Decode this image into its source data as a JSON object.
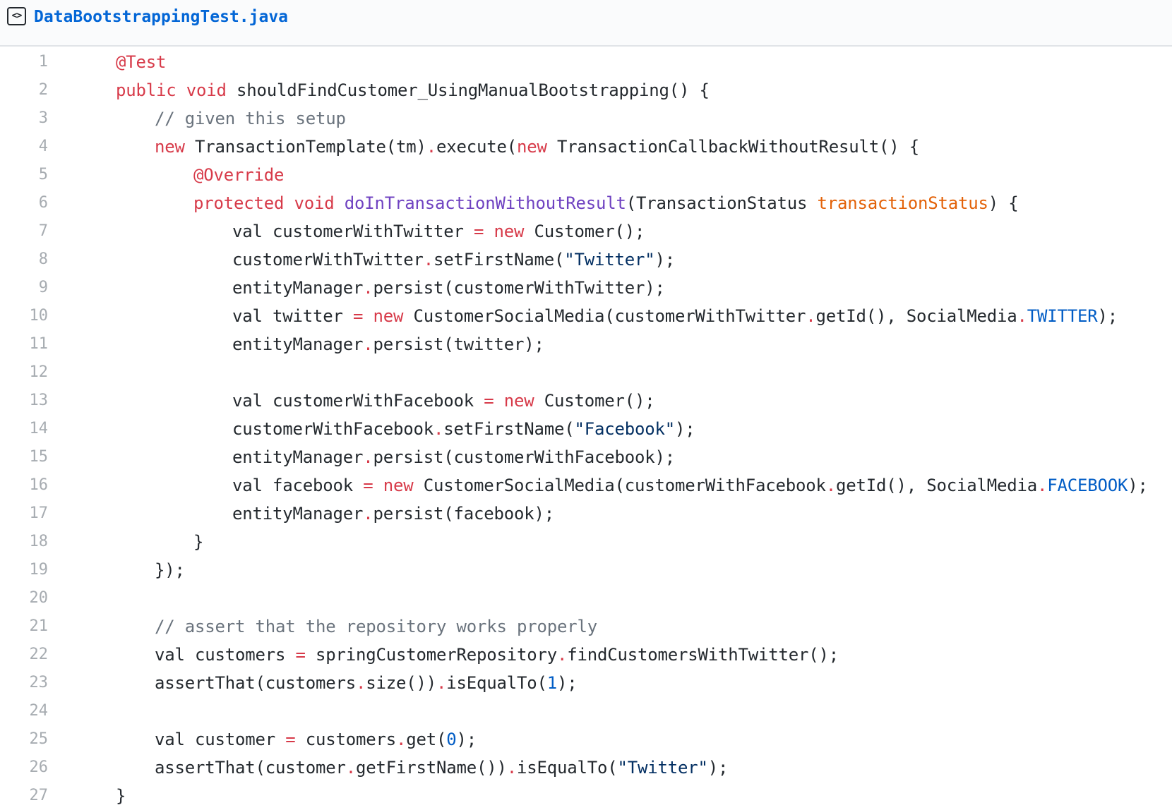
{
  "file": {
    "icon": "code-file-icon",
    "icon_glyph": "<>",
    "name": "DataBootstrappingTest.java"
  },
  "colors": {
    "keyword": "#d73a49",
    "comment": "#6a737d",
    "function": "#6f42c1",
    "parameter": "#e36209",
    "constant": "#005cc5",
    "string": "#032f62",
    "text": "#24292e",
    "line_number": "#a7acb1",
    "link": "#0366d6"
  },
  "code": {
    "lines": [
      {
        "num": "1",
        "indent": 0,
        "tokens": [
          {
            "t": "@Test",
            "c": "an"
          }
        ]
      },
      {
        "num": "2",
        "indent": 0,
        "tokens": [
          {
            "t": "public",
            "c": "kw"
          },
          {
            "t": " "
          },
          {
            "t": "void",
            "c": "kw"
          },
          {
            "t": " shouldFindCustomer_UsingManualBootstrapping() {"
          }
        ]
      },
      {
        "num": "3",
        "indent": 1,
        "tokens": [
          {
            "t": "// given this setup",
            "c": "cm"
          }
        ]
      },
      {
        "num": "4",
        "indent": 1,
        "tokens": [
          {
            "t": "new",
            "c": "kw"
          },
          {
            "t": " TransactionTemplate(tm)"
          },
          {
            "t": ".",
            "c": "op"
          },
          {
            "t": "execute("
          },
          {
            "t": "new",
            "c": "kw"
          },
          {
            "t": " TransactionCallbackWithoutResult() {"
          }
        ]
      },
      {
        "num": "5",
        "indent": 2,
        "tokens": [
          {
            "t": "@Override",
            "c": "an"
          }
        ]
      },
      {
        "num": "6",
        "indent": 2,
        "tokens": [
          {
            "t": "protected",
            "c": "kw"
          },
          {
            "t": " "
          },
          {
            "t": "void",
            "c": "kw"
          },
          {
            "t": " "
          },
          {
            "t": "doInTransactionWithoutResult",
            "c": "fn"
          },
          {
            "t": "(TransactionStatus "
          },
          {
            "t": "transactionStatus",
            "c": "pa"
          },
          {
            "t": ") {"
          }
        ]
      },
      {
        "num": "7",
        "indent": 3,
        "tokens": [
          {
            "t": "val customerWithTwitter "
          },
          {
            "t": "=",
            "c": "op"
          },
          {
            "t": " "
          },
          {
            "t": "new",
            "c": "kw"
          },
          {
            "t": " Customer();"
          }
        ]
      },
      {
        "num": "8",
        "indent": 3,
        "tokens": [
          {
            "t": "customerWithTwitter"
          },
          {
            "t": ".",
            "c": "op"
          },
          {
            "t": "setFirstName("
          },
          {
            "t": "\"Twitter\"",
            "c": "st"
          },
          {
            "t": ");"
          }
        ]
      },
      {
        "num": "9",
        "indent": 3,
        "tokens": [
          {
            "t": "entityManager"
          },
          {
            "t": ".",
            "c": "op"
          },
          {
            "t": "persist(customerWithTwitter);"
          }
        ]
      },
      {
        "num": "10",
        "indent": 3,
        "tokens": [
          {
            "t": "val twitter "
          },
          {
            "t": "=",
            "c": "op"
          },
          {
            "t": " "
          },
          {
            "t": "new",
            "c": "kw"
          },
          {
            "t": " CustomerSocialMedia(customerWithTwitter"
          },
          {
            "t": ".",
            "c": "op"
          },
          {
            "t": "getId(), SocialMedia"
          },
          {
            "t": ".",
            "c": "op"
          },
          {
            "t": "TWITTER",
            "c": "co"
          },
          {
            "t": ");"
          }
        ]
      },
      {
        "num": "11",
        "indent": 3,
        "tokens": [
          {
            "t": "entityManager"
          },
          {
            "t": ".",
            "c": "op"
          },
          {
            "t": "persist(twitter);"
          }
        ]
      },
      {
        "num": "12",
        "indent": 0,
        "tokens": []
      },
      {
        "num": "13",
        "indent": 3,
        "tokens": [
          {
            "t": "val customerWithFacebook "
          },
          {
            "t": "=",
            "c": "op"
          },
          {
            "t": " "
          },
          {
            "t": "new",
            "c": "kw"
          },
          {
            "t": " Customer();"
          }
        ]
      },
      {
        "num": "14",
        "indent": 3,
        "tokens": [
          {
            "t": "customerWithFacebook"
          },
          {
            "t": ".",
            "c": "op"
          },
          {
            "t": "setFirstName("
          },
          {
            "t": "\"Facebook\"",
            "c": "st"
          },
          {
            "t": ");"
          }
        ]
      },
      {
        "num": "15",
        "indent": 3,
        "tokens": [
          {
            "t": "entityManager"
          },
          {
            "t": ".",
            "c": "op"
          },
          {
            "t": "persist(customerWithFacebook);"
          }
        ]
      },
      {
        "num": "16",
        "indent": 3,
        "tokens": [
          {
            "t": "val facebook "
          },
          {
            "t": "=",
            "c": "op"
          },
          {
            "t": " "
          },
          {
            "t": "new",
            "c": "kw"
          },
          {
            "t": " CustomerSocialMedia(customerWithFacebook"
          },
          {
            "t": ".",
            "c": "op"
          },
          {
            "t": "getId(), SocialMedia"
          },
          {
            "t": ".",
            "c": "op"
          },
          {
            "t": "FACEBOOK",
            "c": "co"
          },
          {
            "t": ");"
          }
        ]
      },
      {
        "num": "17",
        "indent": 3,
        "tokens": [
          {
            "t": "entityManager"
          },
          {
            "t": ".",
            "c": "op"
          },
          {
            "t": "persist(facebook);"
          }
        ]
      },
      {
        "num": "18",
        "indent": 2,
        "tokens": [
          {
            "t": "}"
          }
        ]
      },
      {
        "num": "19",
        "indent": 1,
        "tokens": [
          {
            "t": "});"
          }
        ]
      },
      {
        "num": "20",
        "indent": 0,
        "tokens": []
      },
      {
        "num": "21",
        "indent": 1,
        "tokens": [
          {
            "t": "// assert that the repository works properly",
            "c": "cm"
          }
        ]
      },
      {
        "num": "22",
        "indent": 1,
        "tokens": [
          {
            "t": "val customers "
          },
          {
            "t": "=",
            "c": "op"
          },
          {
            "t": " springCustomerRepository"
          },
          {
            "t": ".",
            "c": "op"
          },
          {
            "t": "findCustomersWithTwitter();"
          }
        ]
      },
      {
        "num": "23",
        "indent": 1,
        "tokens": [
          {
            "t": "assertThat(customers"
          },
          {
            "t": ".",
            "c": "op"
          },
          {
            "t": "size())"
          },
          {
            "t": ".",
            "c": "op"
          },
          {
            "t": "isEqualTo("
          },
          {
            "t": "1",
            "c": "co"
          },
          {
            "t": ");"
          }
        ]
      },
      {
        "num": "24",
        "indent": 0,
        "tokens": []
      },
      {
        "num": "25",
        "indent": 1,
        "tokens": [
          {
            "t": "val customer "
          },
          {
            "t": "=",
            "c": "op"
          },
          {
            "t": " customers"
          },
          {
            "t": ".",
            "c": "op"
          },
          {
            "t": "get("
          },
          {
            "t": "0",
            "c": "co"
          },
          {
            "t": ");"
          }
        ]
      },
      {
        "num": "26",
        "indent": 1,
        "tokens": [
          {
            "t": "assertThat(customer"
          },
          {
            "t": ".",
            "c": "op"
          },
          {
            "t": "getFirstName())"
          },
          {
            "t": ".",
            "c": "op"
          },
          {
            "t": "isEqualTo("
          },
          {
            "t": "\"Twitter\"",
            "c": "st"
          },
          {
            "t": ");"
          }
        ]
      },
      {
        "num": "27",
        "indent": 0,
        "tokens": [
          {
            "t": "}"
          }
        ]
      }
    ]
  }
}
